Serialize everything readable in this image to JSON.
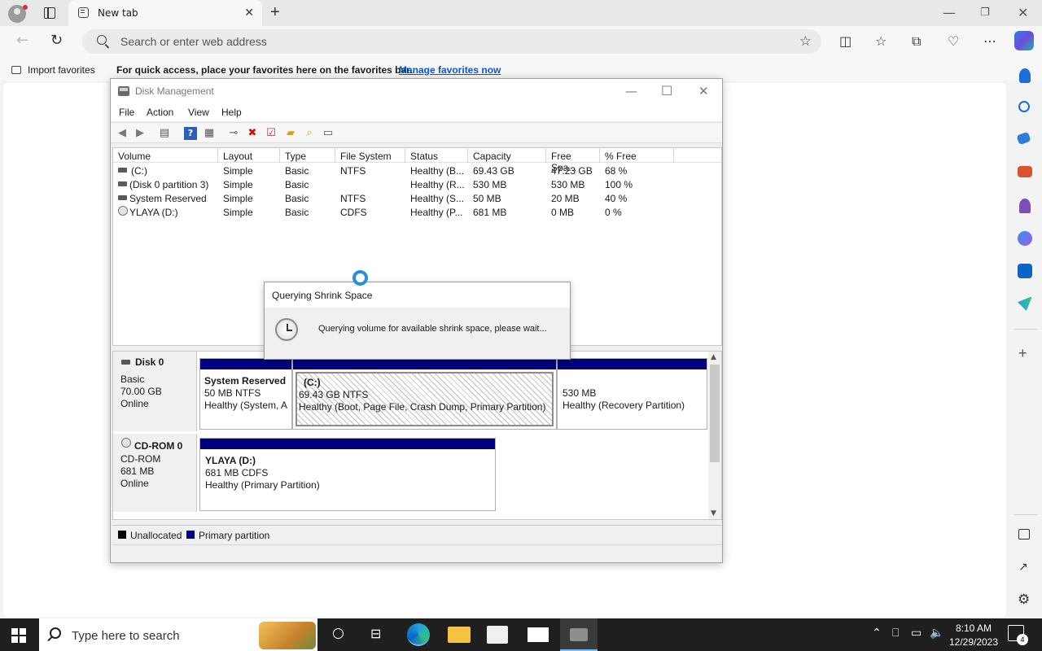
{
  "browser": {
    "tab_title": "New tab",
    "address_placeholder": "Search or enter web address",
    "favorites": {
      "import_label": "Import favorites",
      "message": "For quick access, place your favorites here on the favorites bar.",
      "manage_link": "Manage favorites now"
    }
  },
  "disk_mgmt": {
    "title": "Disk Management",
    "menu": [
      "File",
      "Action",
      "View",
      "Help"
    ],
    "columns": [
      "Volume",
      "Layout",
      "Type",
      "File System",
      "Status",
      "Capacity",
      "Free Spa...",
      "% Free"
    ],
    "volumes": [
      {
        "volume": "(C:)",
        "layout": "Simple",
        "type": "Basic",
        "fs": "NTFS",
        "status": "Healthy (B...",
        "capacity": "69.43 GB",
        "free": "47.23 GB",
        "pct": "68 %",
        "icon": "drive-icon"
      },
      {
        "volume": "(Disk 0 partition 3)",
        "layout": "Simple",
        "type": "Basic",
        "fs": "",
        "status": "Healthy (R...",
        "capacity": "530 MB",
        "free": "530 MB",
        "pct": "100 %",
        "icon": "drive-icon"
      },
      {
        "volume": "System Reserved",
        "layout": "Simple",
        "type": "Basic",
        "fs": "NTFS",
        "status": "Healthy (S...",
        "capacity": "50 MB",
        "free": "20 MB",
        "pct": "40 %",
        "icon": "drive-icon"
      },
      {
        "volume": "YLAYA (D:)",
        "layout": "Simple",
        "type": "Basic",
        "fs": "CDFS",
        "status": "Healthy (P...",
        "capacity": "681 MB",
        "free": "0 MB",
        "pct": "0 %",
        "icon": "cd-icon"
      }
    ],
    "disks": [
      {
        "name": "Disk 0",
        "kind": "Basic",
        "size": "70.00 GB",
        "state": "Online",
        "partitions": [
          {
            "title": "System Reserved",
            "line1": "50 MB NTFS",
            "line2": "Healthy (System, A"
          },
          {
            "title": "(C:)",
            "line1": "69.43 GB NTFS",
            "line2": "Healthy (Boot, Page File, Crash Dump, Primary Partition)"
          },
          {
            "title": "",
            "line1": "530 MB",
            "line2": "Healthy (Recovery Partition)"
          }
        ]
      },
      {
        "name": "CD-ROM 0",
        "kind": "CD-ROM",
        "size": "681 MB",
        "state": "Online",
        "partitions": [
          {
            "title": "YLAYA  (D:)",
            "line1": "681 MB CDFS",
            "line2": "Healthy (Primary Partition)"
          }
        ]
      }
    ],
    "legend": {
      "unallocated": "Unallocated",
      "primary": "Primary partition"
    },
    "colors": {
      "primary": "#00007f",
      "unallocated": "#000000"
    }
  },
  "dialog": {
    "title": "Querying Shrink Space",
    "message": "Querying volume for available shrink space, please wait..."
  },
  "taskbar": {
    "search_placeholder": "Type here to search",
    "time": "8:10 AM",
    "date": "12/29/2023",
    "notification_count": "4"
  }
}
